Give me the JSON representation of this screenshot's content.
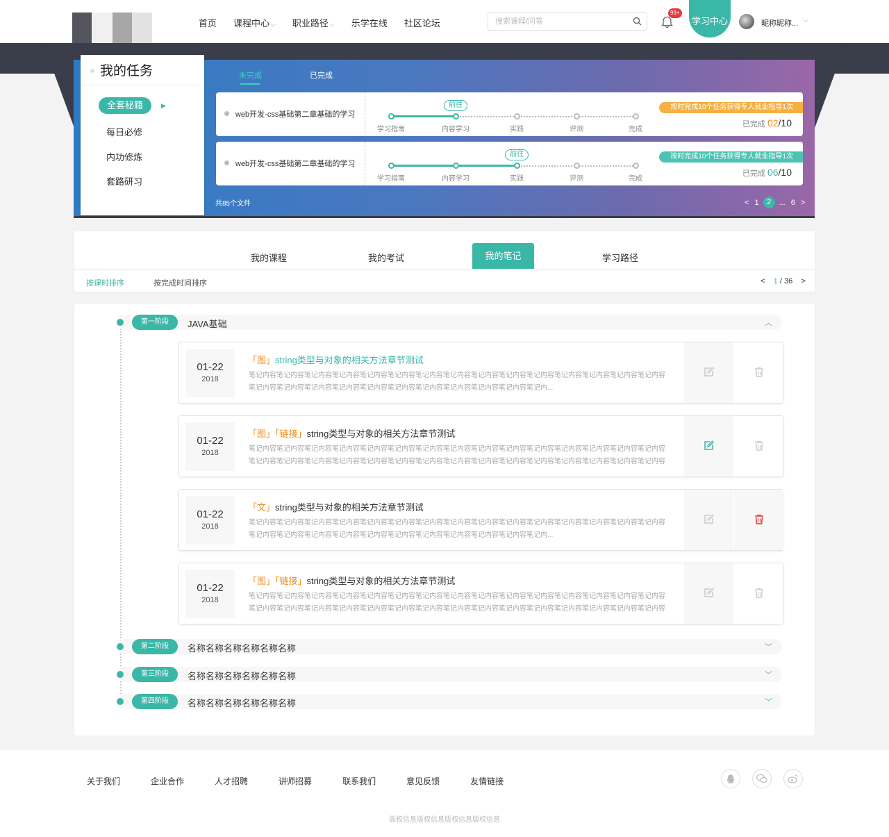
{
  "header": {
    "nav": [
      {
        "label": "首页",
        "chevron": false
      },
      {
        "label": "课程中心",
        "chevron": true
      },
      {
        "label": "职业路径",
        "chevron": true
      },
      {
        "label": "乐学在线",
        "chevron": false
      },
      {
        "label": "社区论坛",
        "chevron": false
      }
    ],
    "search_placeholder": "搜索课程/问答",
    "notif_badge": "99+",
    "learn_center": "学习中心",
    "username": "昵称昵称...",
    "chevron": "⌵"
  },
  "tasks": {
    "title": "我的任务",
    "side_items": [
      "全套秘籍",
      "每日必修",
      "内功修炼",
      "套路研习"
    ],
    "tabs": [
      "未完成",
      "已完成"
    ],
    "steps": [
      "学习指南",
      "内容学习",
      "实践",
      "评测",
      "完成"
    ],
    "go_label": "前往",
    "done_label": "已完成",
    "cards": [
      {
        "title": "web开发-css基础第二章基础的学习",
        "progress_step": 1,
        "ribbon": "按时完成10个任务获得专人就业指导1次",
        "ribbon_color": "#f5b041",
        "done": "02",
        "total": "/10",
        "done_color": "#f08c1a"
      },
      {
        "title": "web开发-css基础第二章基础的学习",
        "progress_step": 2,
        "ribbon": "按时完成10个任务获得专人就业指导1次",
        "ribbon_color": "#4ec3b3",
        "done": "06",
        "total": "/10",
        "done_color": "#3bb7a8"
      }
    ],
    "footer_count": "共85个文件",
    "pager": {
      "prev": "<",
      "p1": "1",
      "current": "2",
      "ellipsis": "...",
      "last": "6",
      "next": ">"
    }
  },
  "main_tabs": [
    "我的课程",
    "我的考试",
    "我的笔记",
    "学习路径"
  ],
  "sort": {
    "by_class": "按课时排序",
    "by_finish": "按完成时间排序"
  },
  "notes_pager": {
    "prev": "<",
    "current": "1",
    "total": "/ 36",
    "next": ">"
  },
  "stages": [
    {
      "tag": "第一阶段",
      "name": "JAVA基础",
      "open": true
    },
    {
      "tag": "第二阶段",
      "name": "名称名称名称名称名称名称",
      "open": false
    },
    {
      "tag": "第三阶段",
      "name": "名称名称名称名称名称名称",
      "open": false
    },
    {
      "tag": "第四阶段",
      "name": "名称名称名称名称名称名称",
      "open": false
    }
  ],
  "chevron_up": "︿",
  "chevron_down": "﹀",
  "notes": [
    {
      "md": "01-22",
      "yr": "2018",
      "tags": [
        "「图」"
      ],
      "title": "string类型与对象的相关方法章节测试",
      "highlight": true,
      "edit_active": false,
      "del_active": false,
      "body": "笔记内容笔记内容笔记内容笔记内容笔记内容笔记内容笔记内容笔记内容笔记内容笔记内容笔记内容笔记内容笔记内容笔记内容笔记内容笔记内容笔记内容笔记内容笔记内容笔记内容笔记内容笔记内容笔记内容笔记内容笔记内容笔记内..."
    },
    {
      "md": "01-22",
      "yr": "2018",
      "tags": [
        "「图」",
        "「链接」"
      ],
      "title": "string类型与对象的相关方法章节测试",
      "highlight": false,
      "edit_active": true,
      "del_active": false,
      "body": "笔记内容笔记内容笔记内容笔记内容笔记内容笔记内容笔记内容笔记内容笔记内容笔记内容笔记内容笔记内容笔记内容笔记内容笔记内容笔记内容笔记内容笔记内容笔记内容笔记内容笔记内容笔记内容笔记内容笔记内容笔记内容笔记内容笔记内容笔记内容笔记内容笔记内容笔记内..."
    },
    {
      "md": "01-22",
      "yr": "2018",
      "tags": [
        "「文」"
      ],
      "title": "string类型与对象的相关方法章节测试",
      "highlight": false,
      "edit_active": false,
      "del_active": true,
      "body": "笔记内容笔记内容笔记内容笔记内容笔记内容笔记内容笔记内容笔记内容笔记内容笔记内容笔记内容笔记内容笔记内容笔记内容笔记内容笔记内容笔记内容笔记内容笔记内容笔记内容笔记内容笔记内容笔记内容笔记内容笔记内容笔记内..."
    },
    {
      "md": "01-22",
      "yr": "2018",
      "tags": [
        "「图」",
        "「链接」"
      ],
      "title": "string类型与对象的相关方法章节测试",
      "highlight": false,
      "edit_active": false,
      "del_active": false,
      "body": "笔记内容笔记内容笔记内容笔记内容笔记内容笔记内容笔记内容笔记内容笔记内容笔记内容笔记内容笔记内容笔记内容笔记内容笔记内容笔记内容笔记内容笔记内容笔记内容笔记内容笔记内容笔记内容笔记内容笔记内容笔记内容笔记内容笔记内容笔记内容笔记内容笔记内容笔记内..."
    }
  ],
  "footer": {
    "links": [
      "关于我们",
      "企业合作",
      "人才招聘",
      "讲师招募",
      "联系我们",
      "意见反馈",
      "友情链接"
    ],
    "social": [
      "qq-icon",
      "wechat-icon",
      "weibo-icon"
    ],
    "copyright": "版权信息版权信息版权信息版权信息"
  },
  "colors": {
    "accent": "#3bb7a8",
    "orange": "#f08c1a",
    "danger": "#e8383d",
    "dark_band": "#3a3d4a"
  }
}
